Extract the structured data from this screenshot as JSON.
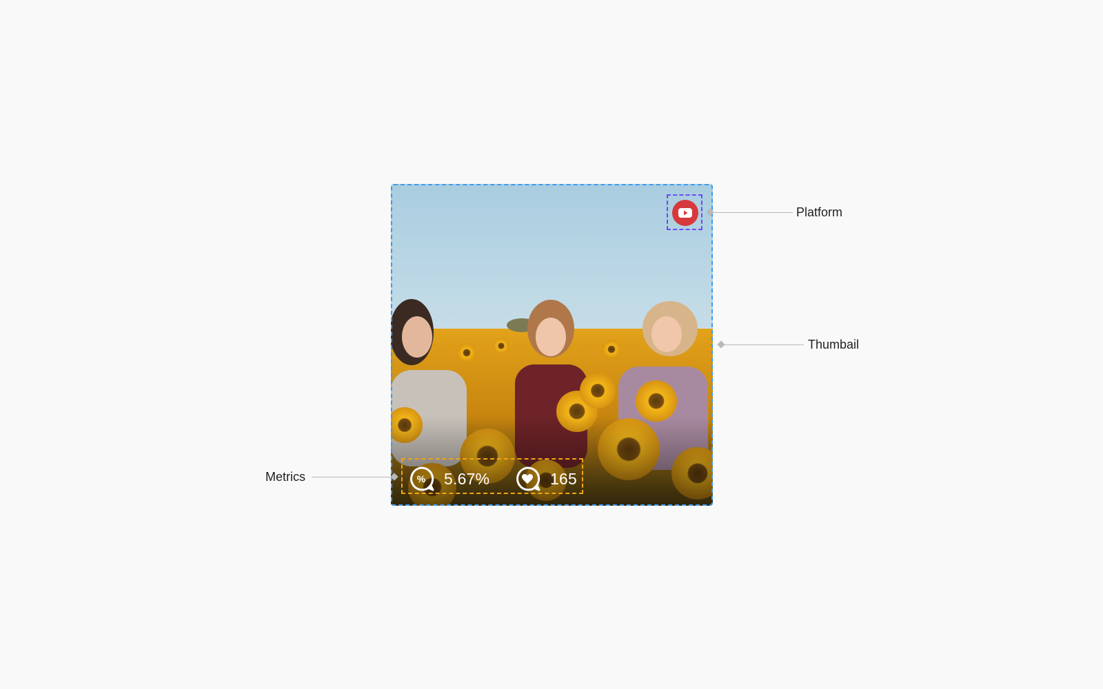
{
  "card": {
    "platform": {
      "icon": "youtube-play-icon",
      "color": "#d6383c"
    },
    "metrics": [
      {
        "icon": "percent-bubble-icon",
        "value": "5.67%"
      },
      {
        "icon": "heart-bubble-icon",
        "value": "165"
      }
    ]
  },
  "annotations": {
    "platform_label": "Platform",
    "thumbnail_label": "Thumbail",
    "metrics_label": "Metrics"
  },
  "colors": {
    "thumbnail_outline": "#3d9bf0",
    "platform_outline": "#6a4cf5",
    "metrics_outline": "#f2a516",
    "leader_line": "#b9b9b9"
  }
}
